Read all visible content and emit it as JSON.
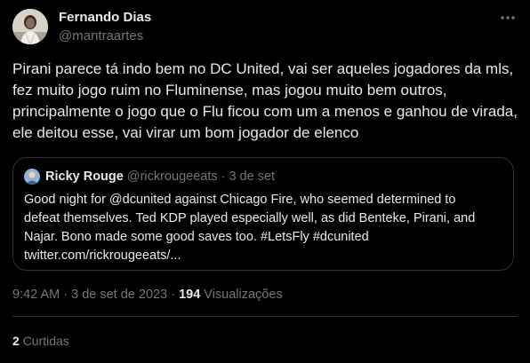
{
  "author": {
    "name": "Fernando Dias",
    "handle": "@mantraartes"
  },
  "more_icon": "more-horizontal-icon",
  "tweet": {
    "text": "Pirani parece tá indo bem no DC United, vai ser aqueles jogadores da mls, fez muito jogo ruim no Fluminense, mas jogou muito bem outros, principalmente o jogo que o Flu ficou com um a menos e ganhou de virada, ele deitou esse, vai virar um bom jogador de elenco"
  },
  "quoted": {
    "name": "Ricky Rouge",
    "handle": "@rickrougeeats",
    "separator": "·",
    "date": "3 de set",
    "lines": [
      "Good night for @dcunited against Chicago Fire, who seemed determined to",
      "defeat themselves. Ted KDP played especially well, as did Benteke, Pirani, and",
      "Najar. Bono made some good saves too. #LetsFly #dcunited",
      "twitter.com/rickrougeeats/..."
    ]
  },
  "meta": {
    "time": "9:42 AM",
    "separator": "·",
    "date": "3 de set de 2023",
    "views_count": "194",
    "views_label": "Visualizações"
  },
  "stats": {
    "retweets_count": "2",
    "retweets_label": "Curtidas"
  },
  "colors": {
    "background": "#000000",
    "text": "#e7e9ea",
    "secondary": "#71767b",
    "border": "#2f3336"
  }
}
